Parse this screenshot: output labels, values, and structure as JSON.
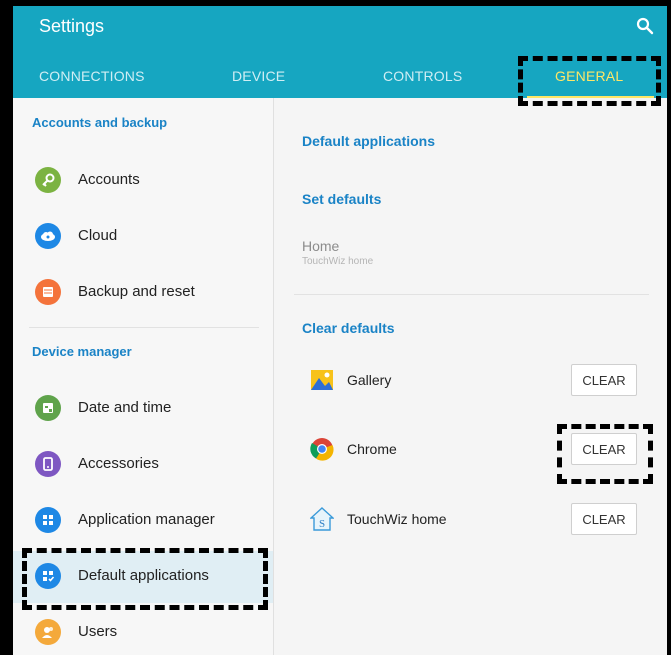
{
  "header": {
    "title": "Settings",
    "tabs": [
      {
        "label": "CONNECTIONS"
      },
      {
        "label": "DEVICE"
      },
      {
        "label": "CONTROLS"
      },
      {
        "label": "GENERAL",
        "active": true
      }
    ]
  },
  "left": {
    "sections": [
      {
        "title": "Accounts and backup"
      },
      {
        "title": "Device manager"
      }
    ],
    "items": [
      {
        "label": "Accounts",
        "color": "#7cb342",
        "icon": "key-icon"
      },
      {
        "label": "Cloud",
        "color": "#1e88e5",
        "icon": "cloud-icon"
      },
      {
        "label": "Backup and reset",
        "color": "#f4733b",
        "icon": "backup-icon"
      },
      {
        "label": "Date and time",
        "color": "#5fa34b",
        "icon": "calendar-icon"
      },
      {
        "label": "Accessories",
        "color": "#7e57c2",
        "icon": "accessories-icon"
      },
      {
        "label": "Application manager",
        "color": "#1e88e5",
        "icon": "grid-icon"
      },
      {
        "label": "Default applications",
        "color": "#1e88e5",
        "icon": "grid-check-icon",
        "selected": true
      },
      {
        "label": "Users",
        "color": "#f4a93b",
        "icon": "users-icon"
      }
    ]
  },
  "right": {
    "title": "Default applications",
    "set_defaults": "Set defaults",
    "home": {
      "title": "Home",
      "subtitle": "TouchWiz home"
    },
    "clear_defaults": "Clear defaults",
    "apps": [
      {
        "name": "Gallery",
        "button": "CLEAR",
        "icon": "gallery-icon"
      },
      {
        "name": "Chrome",
        "button": "CLEAR",
        "icon": "chrome-icon"
      },
      {
        "name": "TouchWiz home",
        "button": "CLEAR",
        "icon": "touchwiz-icon"
      }
    ]
  },
  "colors": {
    "appbar": "#16a6c1",
    "accent": "#1a83c6",
    "active_tab": "#ffe766"
  }
}
